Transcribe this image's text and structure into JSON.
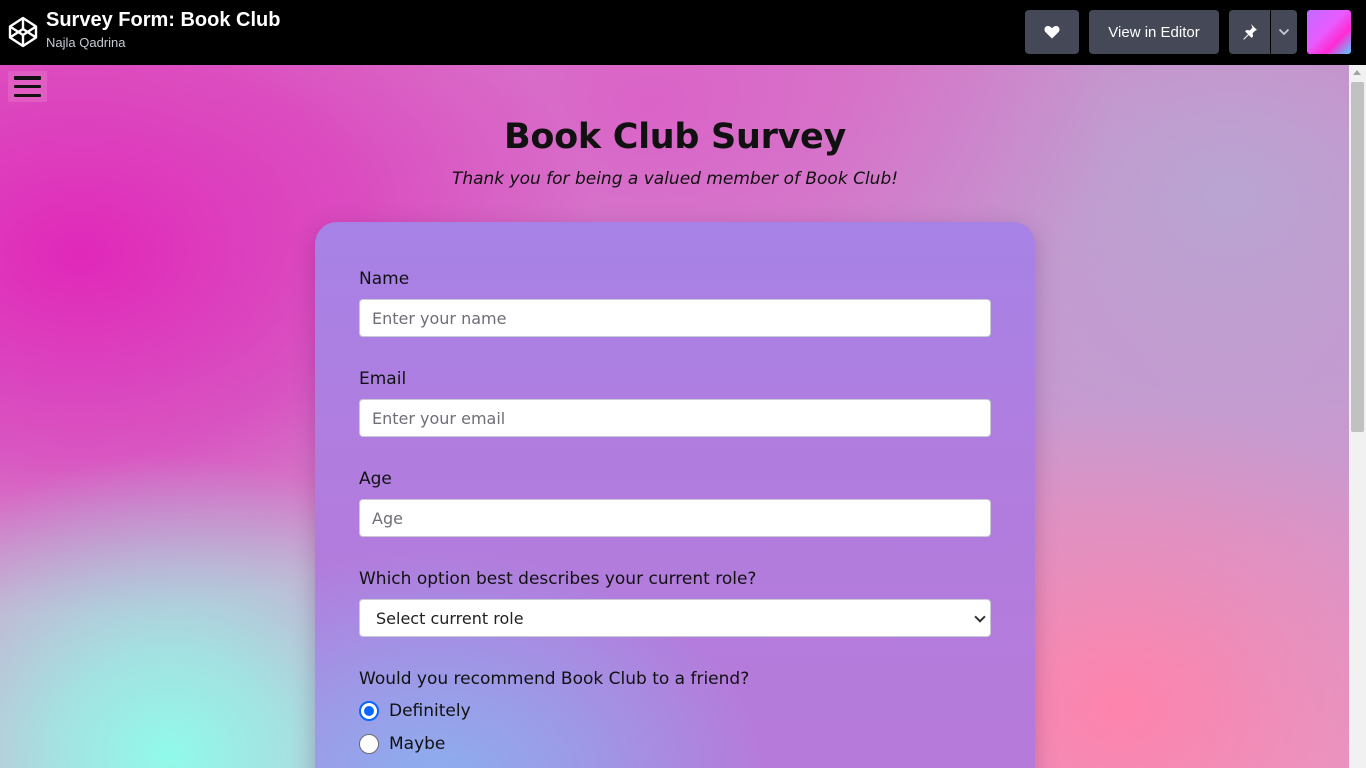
{
  "header": {
    "title": "Survey Form: Book Club",
    "author": "Najla Qadrina",
    "view_in_editor_label": "View in Editor"
  },
  "colors": {
    "topbar": "#000000",
    "button": "#444857",
    "radio_accent": "#0a66ff"
  },
  "icons": {
    "logo": "codepen-logo-icon",
    "like": "heart-icon",
    "pin": "pin-icon",
    "dropdown": "chevron-down-icon",
    "menu": "hamburger-menu-icon"
  },
  "page": {
    "heading": "Book Club Survey",
    "subtitle": "Thank you for being a valued member of Book Club!"
  },
  "form": {
    "name": {
      "label": "Name",
      "placeholder": "Enter your name"
    },
    "email": {
      "label": "Email",
      "placeholder": "Enter your email"
    },
    "age": {
      "label": "Age",
      "placeholder": "Age"
    },
    "role": {
      "label": "Which option best describes your current role?",
      "selected": "Select current role"
    },
    "recommend": {
      "question": "Would you recommend Book Club to a friend?",
      "options": [
        {
          "label": "Definitely",
          "checked": true
        },
        {
          "label": "Maybe",
          "checked": false
        }
      ]
    }
  }
}
